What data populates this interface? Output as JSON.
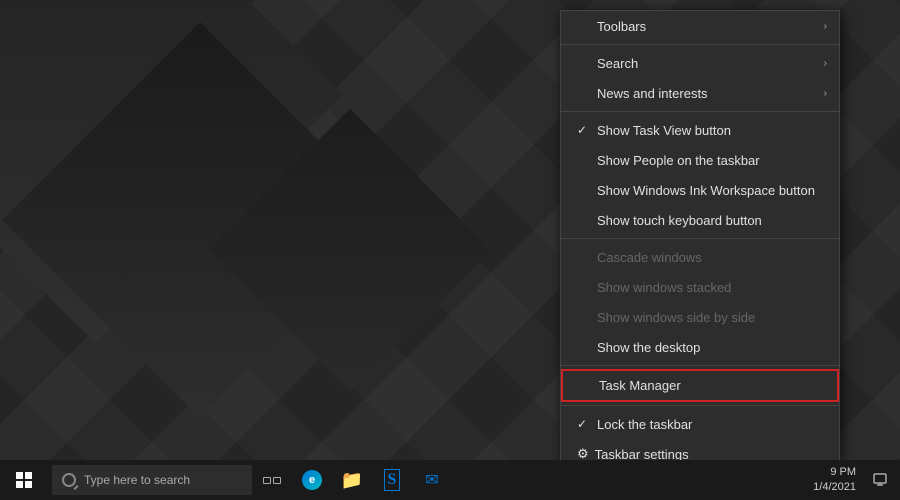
{
  "desktop": {
    "background_desc": "dark geometric diamond pattern"
  },
  "context_menu": {
    "items": [
      {
        "id": "toolbars",
        "label": "Toolbars",
        "has_arrow": true,
        "disabled": false,
        "checked": false,
        "has_gear": false
      },
      {
        "id": "separator1",
        "type": "separator"
      },
      {
        "id": "search",
        "label": "Search",
        "has_arrow": true,
        "disabled": false,
        "checked": false,
        "has_gear": false
      },
      {
        "id": "news",
        "label": "News and interests",
        "has_arrow": true,
        "disabled": false,
        "checked": false,
        "has_gear": false
      },
      {
        "id": "separator2",
        "type": "separator"
      },
      {
        "id": "task_view",
        "label": "Show Task View button",
        "has_arrow": false,
        "disabled": false,
        "checked": true,
        "has_gear": false
      },
      {
        "id": "people",
        "label": "Show People on the taskbar",
        "has_arrow": false,
        "disabled": false,
        "checked": false,
        "has_gear": false
      },
      {
        "id": "ink",
        "label": "Show Windows Ink Workspace button",
        "has_arrow": false,
        "disabled": false,
        "checked": false,
        "has_gear": false
      },
      {
        "id": "keyboard",
        "label": "Show touch keyboard button",
        "has_arrow": false,
        "disabled": false,
        "checked": false,
        "has_gear": false
      },
      {
        "id": "separator3",
        "type": "separator"
      },
      {
        "id": "cascade",
        "label": "Cascade windows",
        "has_arrow": false,
        "disabled": true,
        "checked": false,
        "has_gear": false
      },
      {
        "id": "stacked",
        "label": "Show windows stacked",
        "has_arrow": false,
        "disabled": true,
        "checked": false,
        "has_gear": false
      },
      {
        "id": "side_by_side",
        "label": "Show windows side by side",
        "has_arrow": false,
        "disabled": true,
        "checked": false,
        "has_gear": false
      },
      {
        "id": "show_desktop",
        "label": "Show the desktop",
        "has_arrow": false,
        "disabled": false,
        "checked": false,
        "has_gear": false
      },
      {
        "id": "separator4",
        "type": "separator"
      },
      {
        "id": "task_manager",
        "label": "Task Manager",
        "has_arrow": false,
        "disabled": false,
        "checked": false,
        "has_gear": false,
        "highlighted": true
      },
      {
        "id": "separator5",
        "type": "separator"
      },
      {
        "id": "lock_taskbar",
        "label": "Lock the taskbar",
        "has_arrow": false,
        "disabled": false,
        "checked": true,
        "has_gear": false
      },
      {
        "id": "taskbar_settings",
        "label": "Taskbar settings",
        "has_arrow": false,
        "disabled": false,
        "checked": false,
        "has_gear": true
      }
    ]
  },
  "taskbar": {
    "search_placeholder": "Type here to search",
    "time": "9 PM",
    "date": "1/4/2021",
    "start_label": "Start",
    "notification_label": "Action Center"
  }
}
